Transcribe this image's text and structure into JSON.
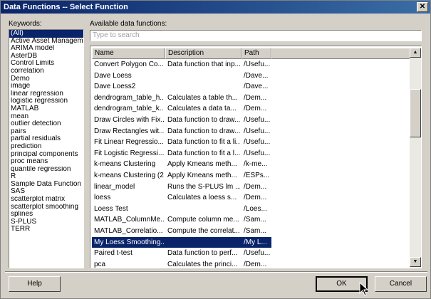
{
  "window": {
    "title": "Data Functions -- Select Function",
    "close_glyph": "✕"
  },
  "keywords": {
    "label": "Keywords:",
    "selected_index": 0,
    "items": [
      "(All)",
      "Active Asset Managem",
      "ARIMA model",
      "AsterDB",
      "Control Limits",
      "correlation",
      "Demo",
      "image",
      "linear regression",
      "logistic regression",
      "MATLAB",
      "mean",
      "outlier detection",
      "pairs",
      "partial residuals",
      "prediction",
      "principal components",
      "proc means",
      "quantile regression",
      "R",
      "Sample Data Function",
      "SAS",
      "scatterplot matrix",
      "scatterplot smoothing",
      "splines",
      "S-PLUS",
      "TERR"
    ]
  },
  "functions": {
    "label": "Available data functions:",
    "search_placeholder": "Type to search",
    "columns": {
      "name": "Name",
      "description": "Description",
      "path": "Path"
    },
    "selected_index": 16,
    "rows": [
      {
        "name": "Convert Polygon Co...",
        "description": "Data function that inp...",
        "path": "/Usefu..."
      },
      {
        "name": "Dave Loess",
        "description": "",
        "path": "/Dave..."
      },
      {
        "name": "Dave Loess2",
        "description": "",
        "path": "/Dave..."
      },
      {
        "name": "dendrogram_table_h...",
        "description": "Calculates a table th...",
        "path": "/Dem..."
      },
      {
        "name": "dendrogram_table_k...",
        "description": "Calculates a data ta...",
        "path": "/Dem..."
      },
      {
        "name": "Draw Circles with Fix...",
        "description": "Data function to draw...",
        "path": "/Usefu..."
      },
      {
        "name": "Draw Rectangles wit...",
        "description": "Data function to draw...",
        "path": "/Usefu..."
      },
      {
        "name": "Fit Linear Regressio...",
        "description": "Data function to fit a li...",
        "path": "/Usefu..."
      },
      {
        "name": "Fit Logistic Regressi...",
        "description": "Data function to fit a l...",
        "path": "/Usefu..."
      },
      {
        "name": "k-means Clustering",
        "description": "Apply Kmeans meth...",
        "path": "/k-me..."
      },
      {
        "name": "k-means Clustering (2)",
        "description": "Apply Kmeans meth...",
        "path": "/ESPs..."
      },
      {
        "name": "linear_model",
        "description": "Runs the S-PLUS lm ...",
        "path": "/Dem..."
      },
      {
        "name": "loess",
        "description": "Calculates a loess s...",
        "path": "/Dem..."
      },
      {
        "name": "Loess Test",
        "description": "",
        "path": "/Loes..."
      },
      {
        "name": "MATLAB_ColumnMe...",
        "description": "Compute column me...",
        "path": "/Sam..."
      },
      {
        "name": "MATLAB_Correlatio...",
        "description": "Compute the correlat...",
        "path": "/Sam..."
      },
      {
        "name": "My Loess Smoothing...",
        "description": "",
        "path": "/My L..."
      },
      {
        "name": "Paired t-test",
        "description": "Data function to perf...",
        "path": "/Usefu..."
      },
      {
        "name": "pca",
        "description": "Calculates the princi...",
        "path": "/Dem..."
      },
      {
        "name": "Points in Polygons fo...",
        "description": "Inputs a set of polyg...",
        "path": "/Usefu..."
      }
    ]
  },
  "buttons": {
    "help": "Help",
    "ok": "OK",
    "cancel": "Cancel"
  },
  "scrollbar": {
    "up_glyph": "▲",
    "down_glyph": "▼"
  },
  "colors": {
    "selection": "#0a246a",
    "title_gradient_start": "#0a246a",
    "title_gradient_end": "#3a6ea5",
    "face": "#d4d0c8"
  }
}
